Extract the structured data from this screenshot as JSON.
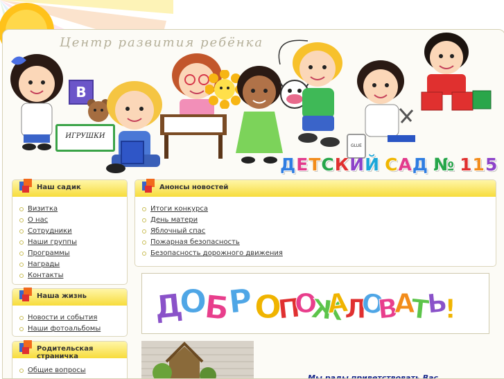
{
  "site": {
    "title": "Центр развития ребёнка",
    "brand": "ДЕТСКИЙ САД № 115",
    "toy_sign": "ИГРУШКИ",
    "block_letter": "B",
    "glue_label": "GLUE",
    "welcome_text": "ДОБРО ПОЖАЛОВАТЬ!"
  },
  "sidebar": {
    "boxes": [
      {
        "title": "Наш садик",
        "items": [
          "Визитка",
          "О нас",
          "Сотрудники",
          "Наши группы",
          "Программы",
          "Награды",
          "Контакты"
        ]
      },
      {
        "title": "Наша жизнь",
        "items": [
          "Новости и события",
          "Наши фотоальбомы"
        ]
      },
      {
        "title": "Родительская страничка",
        "items": [
          "Общие вопросы"
        ]
      }
    ]
  },
  "news": {
    "title": "Анонсы новостей",
    "items": [
      "Итоги конкурса",
      "День матери",
      "Яблочный спас",
      "Пожарная безопасность",
      "Безопасность дорожного движения"
    ]
  },
  "intro": {
    "text": "Мы рады приветствовать Вас"
  },
  "colors": {
    "brand_letters": [
      "#2f7de1",
      "#e23b8c",
      "#f28c1b",
      "#26a64a",
      "#e0302f",
      "#8d43c9",
      "#1aa6d8",
      "#f0b600",
      "#e23b8c",
      "#2f7de1",
      "#26a64a",
      "#e0302f",
      "#f28c1b",
      "#8d43c9",
      "#1aa6d8",
      "#e23b8c",
      "#26a64a"
    ],
    "welcome_letters": [
      "#8a52c9",
      "#4fa6e6",
      "#e83e8c",
      "#4fa6e6",
      "#f0b400",
      "#e03030",
      "#e83e8c",
      "#5cc44a",
      "#f0b400",
      "#e03030",
      "#4fa6e6",
      "#e83e8c",
      "#f28c1b",
      "#5cc44a",
      "#8a52c9",
      "#f0b400",
      "#e03030"
    ]
  }
}
